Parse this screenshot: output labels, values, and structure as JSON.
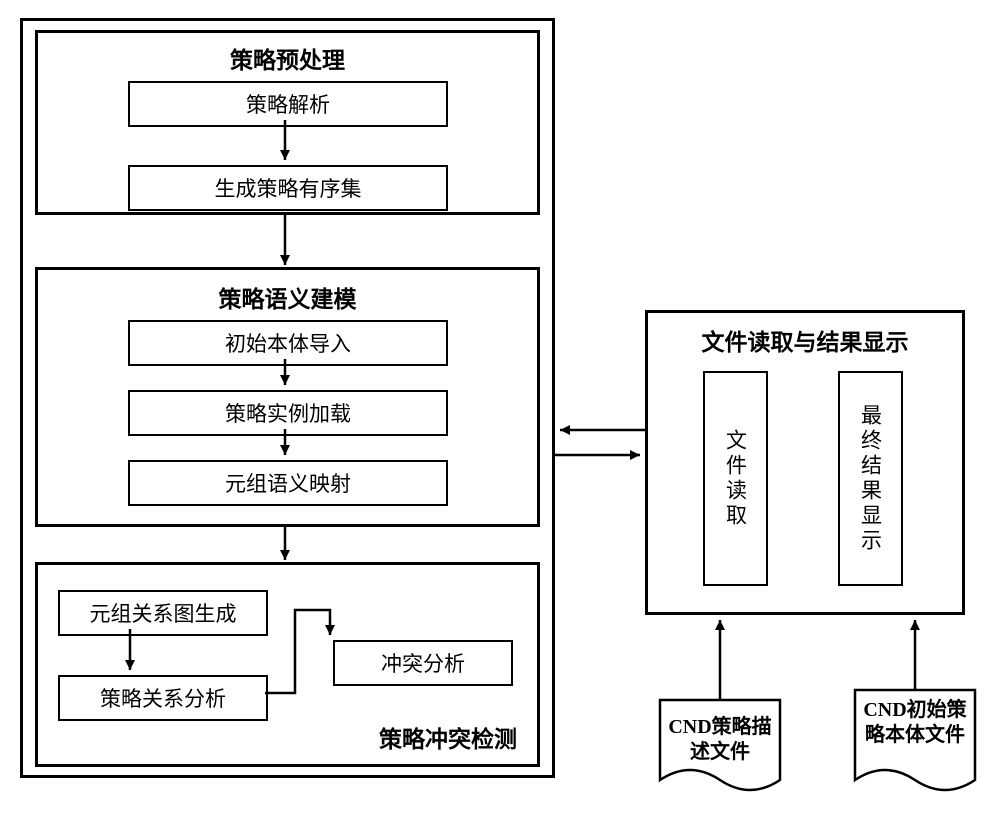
{
  "left": {
    "section1": {
      "title": "策略预处理",
      "step1": "策略解析",
      "step2": "生成策略有序集"
    },
    "section2": {
      "title": "策略语义建模",
      "step1": "初始本体导入",
      "step2": "策略实例加载",
      "step3": "元组语义映射"
    },
    "section3": {
      "title": "策略冲突检测",
      "step1": "元组关系图生成",
      "step2": "策略关系分析",
      "step3": "冲突分析"
    }
  },
  "right": {
    "title": "文件读取与结果显示",
    "col1": "文件读取",
    "col2": "最终结果显示"
  },
  "docs": {
    "doc1": "CND策略描述文件",
    "doc2": "CND初始策略本体文件"
  }
}
